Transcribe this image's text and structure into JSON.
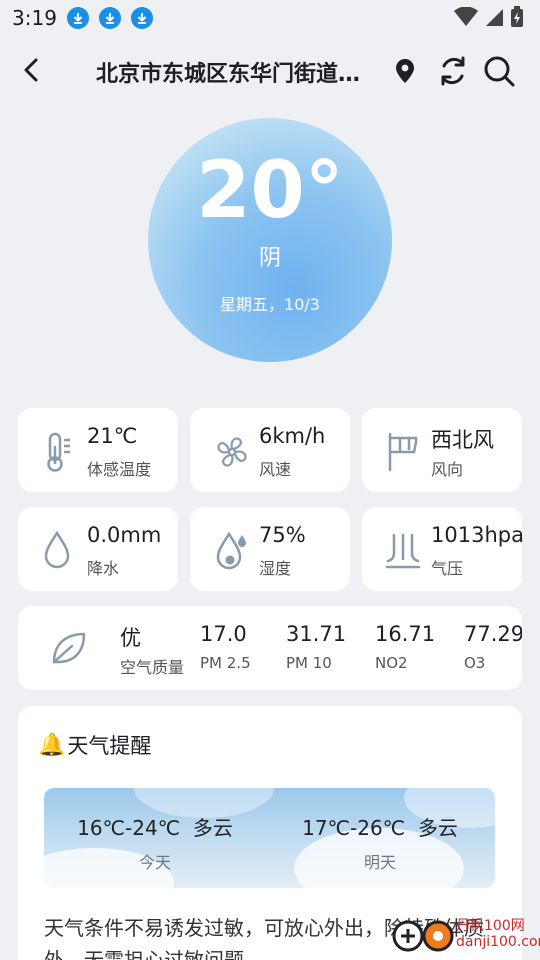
{
  "status_bar": {
    "time": "3:19",
    "download_icons": [
      "download-icon",
      "download-icon",
      "download-icon"
    ]
  },
  "nav": {
    "location": "北京市东城区东华门街道…",
    "icons": [
      "back-arrow-icon",
      "location-pin-icon",
      "refresh-icon",
      "search-icon"
    ]
  },
  "current": {
    "temperature": "20°",
    "condition": "阴",
    "date": "星期五，10/3"
  },
  "details": [
    {
      "value": "21℃",
      "label": "体感温度",
      "icon": "thermometer-icon"
    },
    {
      "value": "6km/h",
      "label": "风速",
      "icon": "fan-icon"
    },
    {
      "value": "西北风",
      "label": "风向",
      "icon": "windsock-icon"
    },
    {
      "value": "0.0mm",
      "label": "降水",
      "icon": "raindrop-icon"
    },
    {
      "value": "75%",
      "label": "湿度",
      "icon": "humidity-icon"
    },
    {
      "value": "1013hpa",
      "label": "气压",
      "icon": "pressure-icon"
    }
  ],
  "air_quality": {
    "grade": "优",
    "grade_label": "空气质量",
    "items": [
      {
        "value": "17.0",
        "label": "PM 2.5"
      },
      {
        "value": "31.71",
        "label": "PM 10"
      },
      {
        "value": "16.71",
        "label": "NO2"
      },
      {
        "value": "77.29",
        "label": "O3"
      }
    ]
  },
  "reminder": {
    "title": "天气提醒",
    "forecast": [
      {
        "range": "16℃-24℃",
        "condition": "多云",
        "day": "今天"
      },
      {
        "range": "17℃-26℃",
        "condition": "多云",
        "day": "明天"
      }
    ],
    "text": "天气条件不易诱发过敏，可放心外出，除特殊体质外，无需担心过敏问题。"
  },
  "watermark": {
    "line1": "丹枫100网",
    "line2": "danji100.com"
  },
  "colors": {
    "accent": "#1b8fe6",
    "icon_gray": "#8a9aaa",
    "background": "#eef0f4"
  }
}
